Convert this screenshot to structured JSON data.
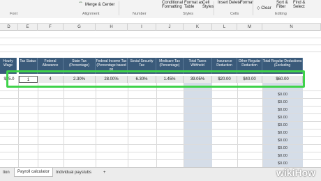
{
  "ribbon": {
    "top": {
      "merge_center": "Merge & Center",
      "conditional": "Conditional",
      "formatting": "Formatting",
      "format_as": "Format as",
      "table": "Table",
      "cell": "Cell",
      "styles_btn": "Styles",
      "insert": "Insert",
      "delete": "Delete",
      "format": "Format",
      "clear": "Clear",
      "sort": "Sort &",
      "filter": "Filter",
      "find": "Find &",
      "select": "Select"
    },
    "groups": {
      "font": "Font",
      "alignment": "Alignment",
      "number": "Number",
      "styles": "Styles",
      "cells": "Cells",
      "editing": "Editing"
    }
  },
  "columns": [
    "D",
    "E",
    "F",
    "G",
    "H",
    "I",
    "J",
    "K",
    "L",
    "M",
    "N"
  ],
  "headers": {
    "hourly": "Hourly Wage",
    "tax_status": "Tax Status",
    "federal_allowance": "Federal Allowance",
    "state_tax": "State Tax (Percentage)",
    "federal_income_tax": "Federal Income Tax (Percentage based on",
    "social_security": "Social Security Tax",
    "medicare": "Medicare Tax (Percentage)",
    "total_taxes": "Total Taxes Withheld",
    "insurance": "Insurance Deduction",
    "other_regular": "Other Regular Deduction",
    "total_regular": "Total Regular Deductions (Excluding"
  },
  "row": {
    "hourly": "$15.0",
    "tax_status": "1",
    "federal_allowance": "4",
    "state_tax": "2.30%",
    "federal_income_tax": "28.00%",
    "social_security": "6.30%",
    "medicare": "1.45%",
    "total_taxes": "39.05%",
    "insurance": "$20.00",
    "other_regular": "$40.00",
    "total_regular": "$60.00"
  },
  "zero_value": "$0.00",
  "tabs": {
    "partial": "tion",
    "payroll": "Payroll calculator",
    "individual": "Individual paystubs",
    "add": "+"
  },
  "watermark": "wikiHow",
  "colors": {
    "header_bg": "#3a5a7a",
    "highlight": "#3fd34a",
    "blue_col": "#d5dde8"
  }
}
